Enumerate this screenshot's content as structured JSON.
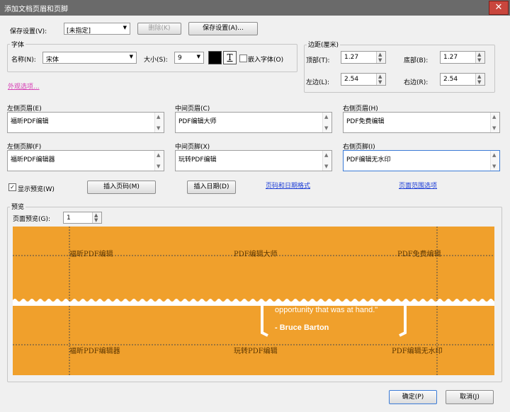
{
  "window": {
    "title": "添加文档页眉和页脚",
    "close": "✕"
  },
  "save_settings": {
    "label": "保存设置(V):",
    "value": "[未指定]",
    "delete_btn": "删除(K)",
    "save_btn": "保存设置(A)..."
  },
  "font": {
    "group_label": "字体",
    "name_label": "名称(N):",
    "name_value": "宋体",
    "size_label": "大小(S):",
    "size_value": "9",
    "color": "#000000",
    "underline_icon": "T",
    "embed_label": "嵌入字体(O)"
  },
  "margins": {
    "group_label": "边距(厘米)",
    "top_label": "顶部(T):",
    "top_value": "1.27",
    "bottom_label": "底部(B):",
    "bottom_value": "1.27",
    "left_label": "左边(L):",
    "left_value": "2.54",
    "right_label": "右边(R):",
    "right_value": "2.54"
  },
  "appearance_link": "外观选项...",
  "header": {
    "left_label": "左侧页眉(E)",
    "left_value": "福昕PDF编辑",
    "center_label": "中间页眉(C)",
    "center_value": "PDF编辑大师",
    "right_label": "右侧页眉(H)",
    "right_value": "PDF免费编辑"
  },
  "footer": {
    "left_label": "左侧页脚(F)",
    "left_value": "福昕PDF编辑器",
    "center_label": "中间页脚(X)",
    "center_value": "玩转PDF编辑",
    "right_label": "右侧页脚(I)",
    "right_value": "PDF编辑无水印"
  },
  "show_preview": {
    "label": "显示预览(W)",
    "checked": true
  },
  "insert_page_btn": "插入页码(M)",
  "insert_date_btn": "插入日期(D)",
  "page_date_format_link": "页码和日期格式",
  "page_range_link": "页面范围选项",
  "preview": {
    "group_label": "预览",
    "page_label": "页面预览(G):",
    "page_value": "1",
    "bg_color": "#f0a02c",
    "header_left": "福昕PDF编辑",
    "header_center": "PDF编辑大师",
    "header_right": "PDF免费编辑",
    "footer_left": "福昕PDF编辑器",
    "footer_center": "玩转PDF编辑",
    "footer_right": "PDF编辑无水印",
    "quote_line": "opportunity that was at hand.\"",
    "quote_author": "- Bruce Barton"
  },
  "ok_btn": "确定(P)",
  "cancel_btn": "取消(J)"
}
